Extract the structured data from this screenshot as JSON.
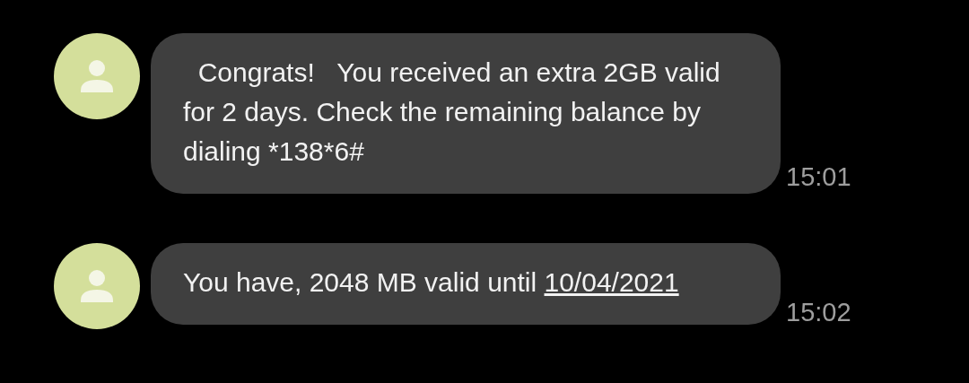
{
  "messages": [
    {
      "text": "  Congrats!   You received an extra 2GB valid for 2 days. Check the remaining balance by   dialing *138*6#",
      "time": "15:01"
    },
    {
      "text": "You have, 2048 MB valid until ",
      "link": "10/04/2021",
      "time": "15:02"
    }
  ]
}
